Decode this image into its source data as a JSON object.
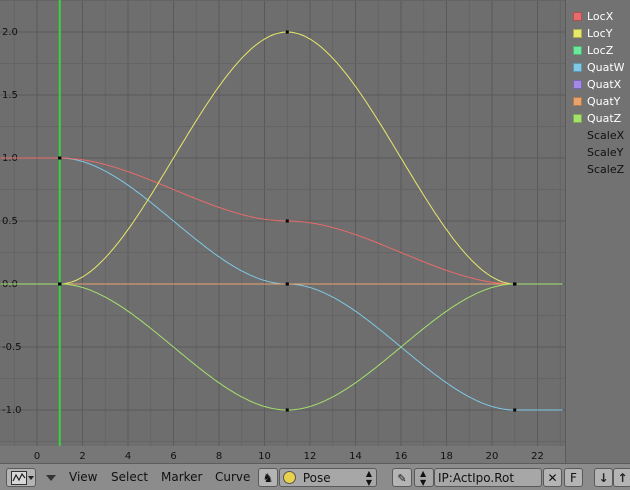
{
  "graph": {
    "background": "#6e6e6e",
    "grid_minor": "#646464",
    "grid_major": "#5a5a5a",
    "current_frame": 1,
    "current_frame_color": "#39d439",
    "y_ticks": [
      {
        "v": 2.0,
        "label": "2.0"
      },
      {
        "v": 1.5,
        "label": "1.5"
      },
      {
        "v": 1.0,
        "label": "1.0"
      },
      {
        "v": 0.5,
        "label": "0.5"
      },
      {
        "v": 0.0,
        "label": "0.0"
      },
      {
        "v": -0.5,
        "label": "-0.5"
      },
      {
        "v": -1.0,
        "label": "-1.0"
      }
    ],
    "x_ticks": [
      {
        "v": 0,
        "label": "0"
      },
      {
        "v": 2,
        "label": "2"
      },
      {
        "v": 4,
        "label": "4"
      },
      {
        "v": 6,
        "label": "6"
      },
      {
        "v": 8,
        "label": "8"
      },
      {
        "v": 10,
        "label": "10"
      },
      {
        "v": 12,
        "label": "12"
      },
      {
        "v": 14,
        "label": "14"
      },
      {
        "v": 16,
        "label": "16"
      },
      {
        "v": 18,
        "label": "18"
      },
      {
        "v": 20,
        "label": "20"
      },
      {
        "v": 22,
        "label": "22"
      }
    ],
    "curves": [
      {
        "name": "QuatW",
        "color": "#7fc8e6",
        "kind": "interp",
        "keys": [
          [
            1,
            1.0
          ],
          [
            11,
            0.0
          ],
          [
            21,
            -1.0
          ]
        ]
      },
      {
        "name": "LocX",
        "color": "#e86b6b",
        "kind": "interp",
        "keys": [
          [
            1,
            1.0
          ],
          [
            11,
            0.5
          ],
          [
            21,
            0.0
          ]
        ]
      },
      {
        "name": "QuatY",
        "color": "#eba36d",
        "kind": "flat",
        "keys": [
          [
            1,
            0.0
          ],
          [
            11,
            0.0
          ],
          [
            21,
            0.0
          ]
        ]
      },
      {
        "name": "LocY",
        "color": "#e8e86a",
        "kind": "interp",
        "keys": [
          [
            1,
            0.0
          ],
          [
            11,
            2.0
          ],
          [
            21,
            0.0
          ]
        ]
      },
      {
        "name": "QuatZ",
        "color": "#a4e26c",
        "kind": "interp",
        "keys": [
          [
            1,
            0.0
          ],
          [
            11,
            -1.0
          ],
          [
            21,
            0.0
          ]
        ]
      }
    ]
  },
  "channels": [
    {
      "label": "LocX",
      "color": "#e86b6b"
    },
    {
      "label": "LocY",
      "color": "#e8e86a"
    },
    {
      "label": "LocZ",
      "color": "#6be89c"
    },
    {
      "label": "QuatW",
      "color": "#7fc8e6"
    },
    {
      "label": "QuatX",
      "color": "#a28ae6"
    },
    {
      "label": "QuatY",
      "color": "#eba36d"
    },
    {
      "label": "QuatZ",
      "color": "#a4e26c"
    },
    {
      "label": "ScaleX",
      "color": null
    },
    {
      "label": "ScaleY",
      "color": null
    },
    {
      "label": "ScaleZ",
      "color": null
    }
  ],
  "header": {
    "editor_icon": "ipo-curve-editor-icon",
    "menus": {
      "view": "View",
      "select": "Select",
      "marker": "Marker",
      "curve": "Curve"
    },
    "mode_select": "Pose",
    "ipo_block": "IP:ActIpo.Rot",
    "unlink_label": "✕",
    "fake_user_label": "F"
  }
}
